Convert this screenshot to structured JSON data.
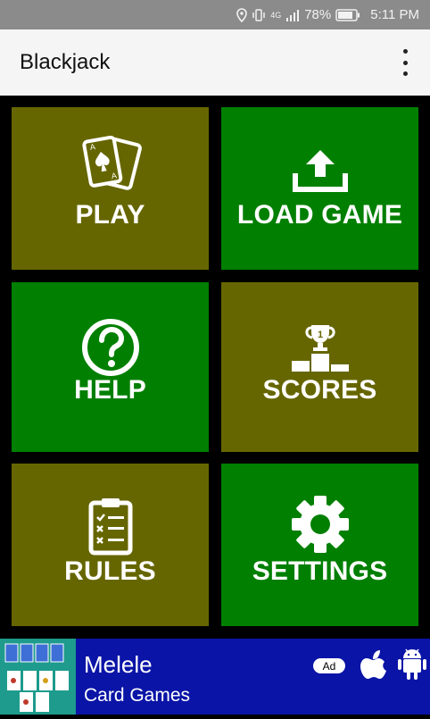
{
  "status_bar": {
    "network": "4G",
    "battery": "78%",
    "time": "5:11 PM"
  },
  "app_bar": {
    "title": "Blackjack"
  },
  "menu": [
    {
      "label": "PLAY",
      "icon": "cards-icon",
      "color": "#666600"
    },
    {
      "label": "LOAD GAME",
      "icon": "upload-icon",
      "color": "#007f00"
    },
    {
      "label": "HELP",
      "icon": "question-icon",
      "color": "#007f00"
    },
    {
      "label": "SCORES",
      "icon": "trophy-podium-icon",
      "color": "#666600"
    },
    {
      "label": "RULES",
      "icon": "clipboard-checklist-icon",
      "color": "#666600"
    },
    {
      "label": "SETTINGS",
      "icon": "gear-icon",
      "color": "#007f00"
    }
  ],
  "ad": {
    "title": "Melele",
    "subtitle": "Card Games",
    "badge": "Ad",
    "background": "#0a14a6"
  }
}
